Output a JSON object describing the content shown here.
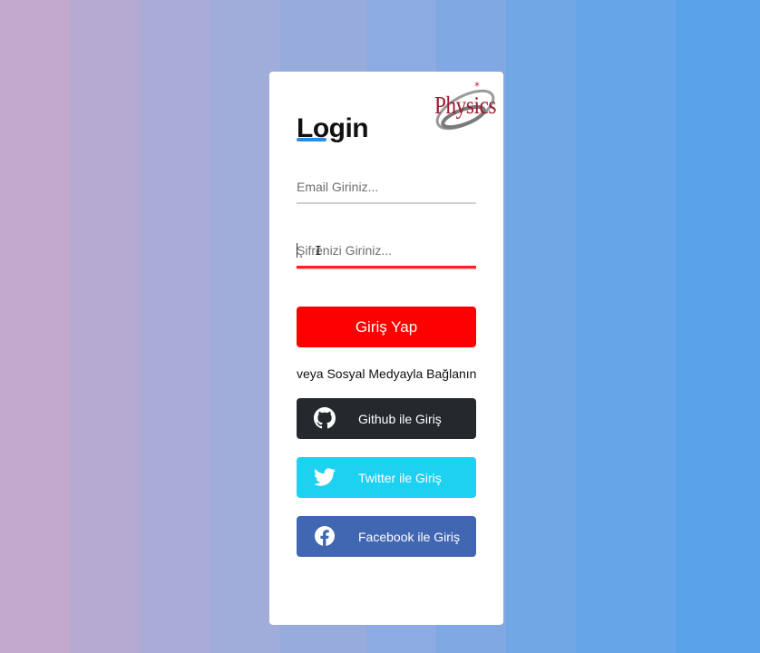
{
  "logo": {
    "text": "Physics"
  },
  "form": {
    "title": "Login",
    "email_placeholder": "Email Giriniz...",
    "password_placeholder": "Şifrenizi Giriniz...",
    "submit_label": "Giriş Yap",
    "social_text": "veya Sosyal Medyayla Bağlanın"
  },
  "social": {
    "github_label": "Github ile Giriş",
    "twitter_label": "Twitter ile Giriş",
    "facebook_label": "Facebook ile Giriş"
  },
  "colors": {
    "submit": "#ff0000",
    "github": "#24292e",
    "twitter": "#1dd1f1",
    "facebook": "#4267b2",
    "title_underline": "#2b8de0"
  }
}
